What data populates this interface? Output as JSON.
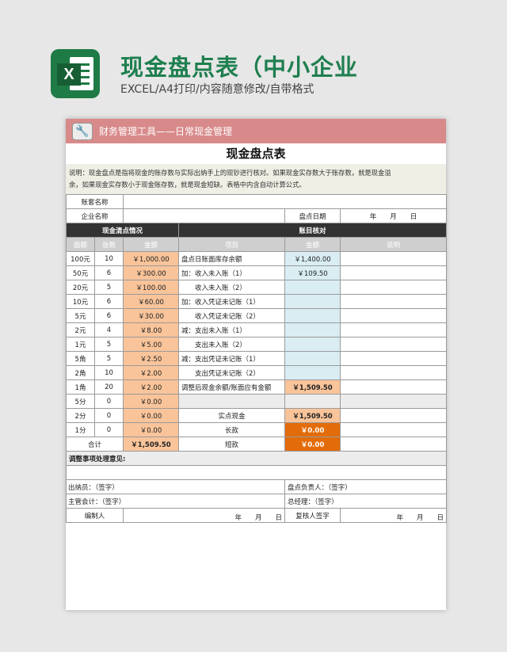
{
  "header": {
    "title": "现金盘点表（中小企业",
    "subtitle": "EXCEL/A4打印/内容随意修改/自带格式",
    "icon": "excel-icon"
  },
  "sheet": {
    "toolbar": "财务管理工具——日常现金管理",
    "title": "现金盘点表",
    "desc_line1": "说明：现金盘点是指将现金的账存数与实际出纳手上的现钞进行核对。如果现金实存数大于账存数，就是现金溢",
    "desc_line2": "余，如果现金实存数小于现金账存数，就是现金短缺。表格中内含自动计算公式。",
    "labels": {
      "account": "账套名称",
      "company": "企业名称",
      "date_label": "盘点日期",
      "date_value": "年　　月　　日",
      "count_section": "现金清点情况",
      "verify_section": "账目核对",
      "col_denom": "面额",
      "col_count": "张数",
      "col_amount": "金额",
      "col_item": "项目",
      "col_amount2": "金额",
      "col_note": "说明",
      "total": "合计",
      "total_value": "￥1,509.50",
      "adjust": "调整事项处理意见:",
      "cashier": "出纳员：（签字）",
      "counter": "盘点负责人：（签字）",
      "accountant": "主管会计：（签字）",
      "manager": "总经理：（签字）",
      "prepared": "编制人",
      "reviewer": "复核人签字",
      "ymd": "年　　月　　日"
    },
    "rows": [
      {
        "denom": "100元",
        "count": "10",
        "amount": "￥1,000.00",
        "item": "盘点日账面库存余额",
        "item_amount": "￥1,400.00"
      },
      {
        "denom": "50元",
        "count": "6",
        "amount": "￥300.00",
        "item": "加：收入未入账（1）",
        "item_amount": "￥109.50"
      },
      {
        "denom": "20元",
        "count": "5",
        "amount": "￥100.00",
        "item": "　　收入未入账（2）",
        "item_amount": ""
      },
      {
        "denom": "10元",
        "count": "6",
        "amount": "￥60.00",
        "item": "加：收入凭证未记账（1）",
        "item_amount": ""
      },
      {
        "denom": "5元",
        "count": "6",
        "amount": "￥30.00",
        "item": "　　收入凭证未记账（2）",
        "item_amount": ""
      },
      {
        "denom": "2元",
        "count": "4",
        "amount": "￥8.00",
        "item": "减：支出未入账（1）",
        "item_amount": ""
      },
      {
        "denom": "1元",
        "count": "5",
        "amount": "￥5.00",
        "item": "　　支出未入账（2）",
        "item_amount": ""
      },
      {
        "denom": "5角",
        "count": "5",
        "amount": "￥2.50",
        "item": "减：支出凭证未记账（1）",
        "item_amount": ""
      },
      {
        "denom": "2角",
        "count": "10",
        "amount": "￥2.00",
        "item": "　　支出凭证未记账（2）",
        "item_amount": ""
      },
      {
        "denom": "1角",
        "count": "20",
        "amount": "￥2.00",
        "item": "调整后现金余额/账面应有金额",
        "item_amount": "￥1,509.50"
      },
      {
        "denom": "5分",
        "count": "0",
        "amount": "￥0.00",
        "item": "",
        "item_amount": ""
      },
      {
        "denom": "2分",
        "count": "0",
        "amount": "￥0.00",
        "item": "实点现金",
        "item_amount": "￥1,509.50"
      },
      {
        "denom": "1分",
        "count": "0",
        "amount": "￥0.00",
        "item": "长款",
        "item_amount": "￥0.00"
      }
    ],
    "short_label": "短款",
    "short_value": "￥0.00"
  }
}
